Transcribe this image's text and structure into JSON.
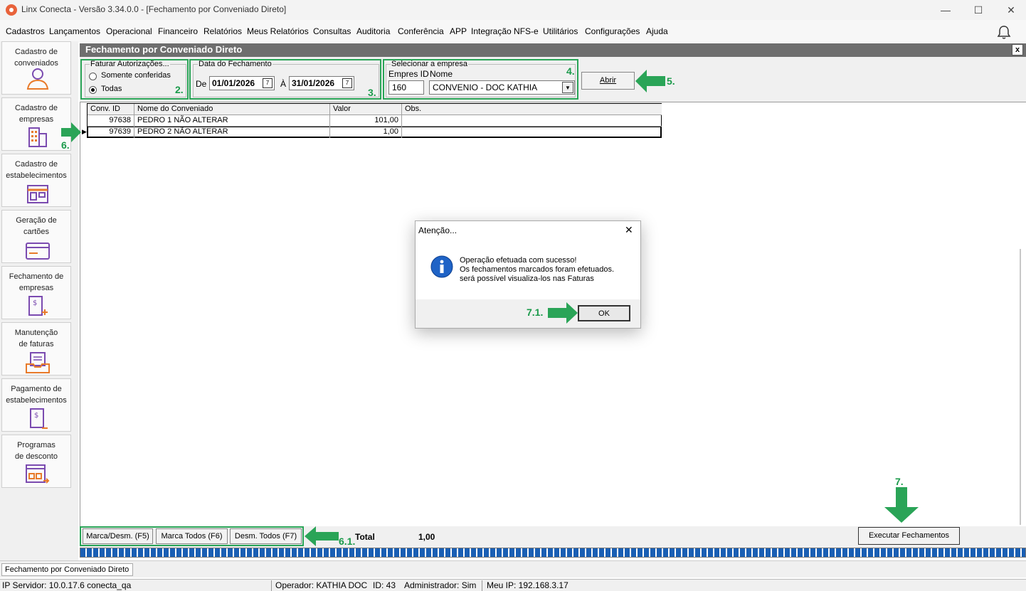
{
  "window": {
    "title": "Linx Conecta - Versão 3.34.0.0 - [Fechamento por Conveniado Direto]",
    "minimize": "—",
    "maximize": "☐",
    "close": "✕"
  },
  "menu": [
    "Cadastros",
    "Lançamentos",
    "Operacional",
    "Financeiro",
    "Relatórios",
    "Meus Relatórios",
    "Consultas",
    "Auditoria",
    "Conferência",
    "APP",
    "Integração NFS-e",
    "Utilitários",
    "Configurações",
    "Ajuda"
  ],
  "sidebar": [
    {
      "label": "Cadastro de\nconveniados",
      "icon": "person-icon"
    },
    {
      "label": "Cadastro de\nempresas",
      "icon": "building-icon"
    },
    {
      "label": "Cadastro de\nestabelecimentos",
      "icon": "store-icon"
    },
    {
      "label": "Geração de\ncartões",
      "icon": "card-icon"
    },
    {
      "label": "Fechamento de\nempresas",
      "icon": "invoice-plus-icon"
    },
    {
      "label": "Manutenção\nde faturas",
      "icon": "inbox-icon"
    },
    {
      "label": "Pagamento de\nestabelecimentos",
      "icon": "receipt-icon"
    },
    {
      "label": "Programas\nde desconto",
      "icon": "discount-program-icon"
    }
  ],
  "form": {
    "title": "Fechamento por Conveniado Direto",
    "close": "x",
    "faturar": {
      "legend": "Faturar Autorizações...",
      "option1": "Somente conferidas",
      "option2": "Todas",
      "selected": "Todas"
    },
    "data": {
      "legend": "Data do Fechamento",
      "de_label": "De",
      "de_value": "01/01/2026",
      "ate_label": "À",
      "ate_value": "31/01/2026"
    },
    "empresa": {
      "legend": "Selecionar a empresa",
      "id_label": "Empres ID",
      "nome_label": "Nome",
      "id_value": "160",
      "nome_value": "CONVENIO -  DOC KATHIA"
    },
    "abrir": "Abrir"
  },
  "steps": {
    "s2": "2.",
    "s3": "3.",
    "s4": "4.",
    "s5": "5.",
    "s6": "6.",
    "s61": "6.1.",
    "s7": "7.",
    "s71": "7.1."
  },
  "grid": {
    "columns": [
      "Conv. ID",
      "Nome do Conveniado",
      "Valor",
      "Obs."
    ],
    "rows": [
      {
        "id": "97638",
        "nome": "PEDRO 1 NÃO ALTERAR",
        "valor": "101,00",
        "obs": ""
      },
      {
        "id": "97639",
        "nome": "PEDRO 2 NÃO ALTERAR",
        "valor": "1,00",
        "obs": ""
      }
    ]
  },
  "bottom": {
    "marca": "Marca/Desm. (F5)",
    "marca_todos": "Marca Todos (F6)",
    "desm_todos": "Desm. Todos (F7)",
    "total_label": "Total",
    "total_value": "1,00",
    "executar": "Executar Fechamentos"
  },
  "status": {
    "tab": "Fechamento por Conveniado Direto",
    "ip_servidor": "IP Servidor: 10.0.17.6 conecta_qa",
    "operador": "Operador: KATHIA DOC",
    "id": "ID: 43",
    "admin": "Administrador: Sim",
    "meu_ip": "Meu IP: 192.168.3.17"
  },
  "dialog": {
    "title": "Atenção...",
    "close": "✕",
    "line1": "Operação efetuada com sucesso!",
    "line2": "Os fechamentos marcados foram efetuados.",
    "line3": "será possível visualiza-los nas Faturas",
    "ok": "OK"
  },
  "colors": {
    "accent_green": "#2aa457",
    "progress_blue": "#1a5fb4",
    "header_gray": "#6e6e6e"
  }
}
